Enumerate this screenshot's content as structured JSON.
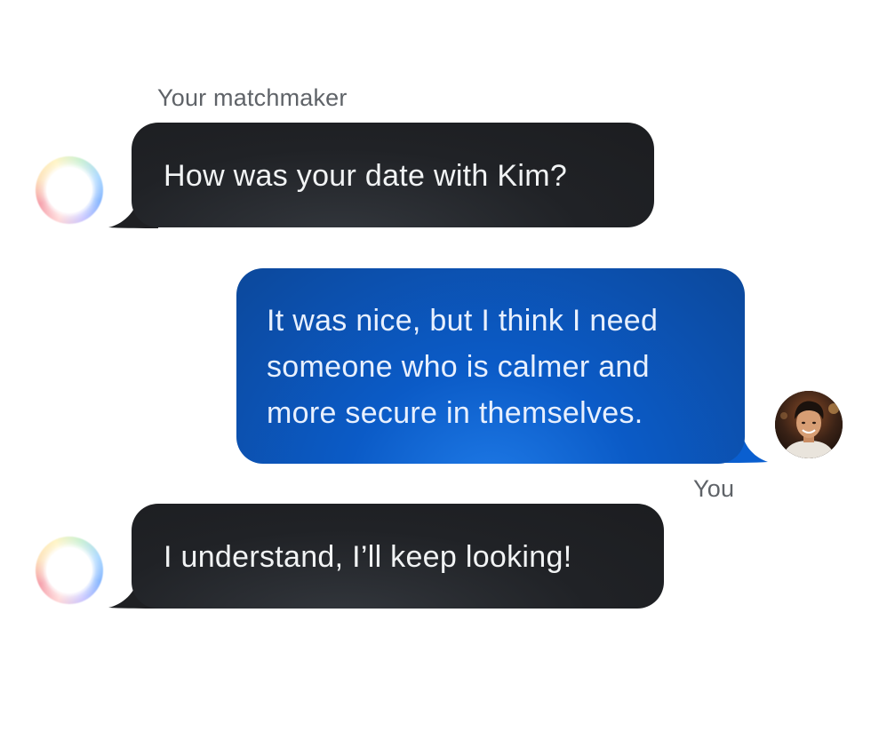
{
  "chat": {
    "matchmaker_label": "Your matchmaker",
    "you_label": "You",
    "messages": [
      {
        "from": "matchmaker",
        "lines": [
          "How was your date with Kim?"
        ]
      },
      {
        "from": "you",
        "lines": [
          "It was nice, but I think I need",
          "someone who is calmer and",
          "more secure in themselves."
        ]
      },
      {
        "from": "matchmaker",
        "lines": [
          "I understand, I’ll keep looking!"
        ]
      }
    ]
  },
  "icons": {
    "matchmaker_avatar": "gradient-orb-icon",
    "user_avatar": "user-photo"
  },
  "colors": {
    "dark_bubble": "#1f2023",
    "blue_bubble": "#0b5bc7",
    "label_text": "#5f6368",
    "background": "#ffffff"
  }
}
